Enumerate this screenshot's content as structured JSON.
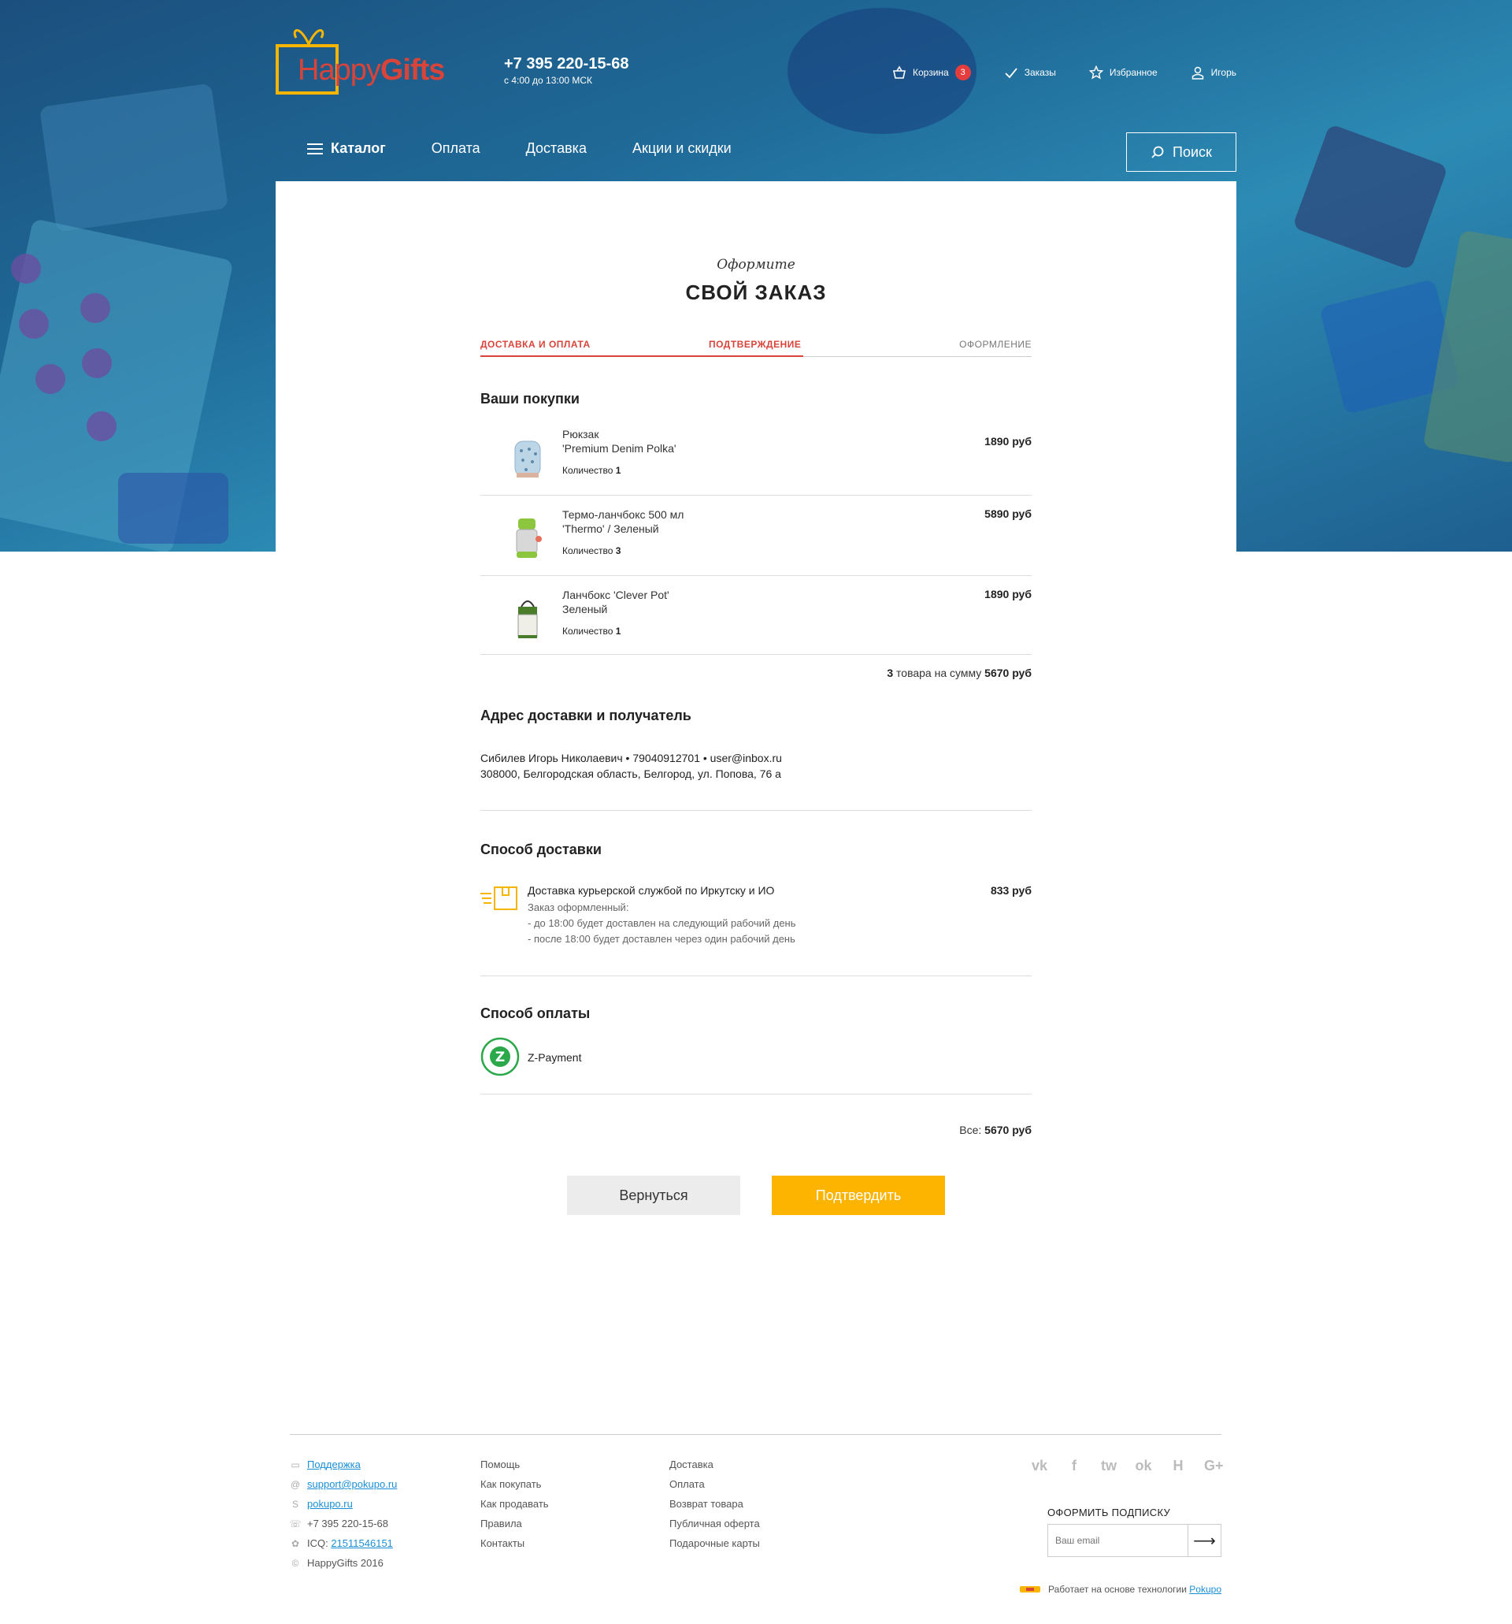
{
  "brand": {
    "logo_light": "Happy",
    "logo_bold": "Gifts",
    "phone": "+7 395 220-15-68",
    "hours": "с 4:00 до 13:00 МСК",
    "accent": "#d9443a",
    "gold": "#f7b500"
  },
  "topnav": {
    "cart_label": "Корзина",
    "cart_count": "3",
    "orders_label": "Заказы",
    "favorites_label": "Избранное",
    "user_label": "Игорь"
  },
  "mainnav": {
    "catalog": "Каталог",
    "payment": "Оплата",
    "delivery": "Доставка",
    "promos": "Акции и скидки",
    "search": "Поиск"
  },
  "checkout": {
    "subtitle": "Оформите",
    "title": "СВОЙ ЗАКАЗ",
    "steps": [
      "ДОСТАВКА И ОПЛАТА",
      "ПОДТВЕРЖДЕНИЕ",
      "ОФОРМЛЕНИЕ"
    ],
    "purchases_title": "Ваши покупки",
    "qty_label": "Количество",
    "products": [
      {
        "line1": "Рюкзак",
        "line2": "'Premium Denim Polka'",
        "qty": "1",
        "price": "1890 руб"
      },
      {
        "line1": "Термо-ланчбокс 500 мл",
        "line2": "'Thermo' / Зеленый",
        "qty": "3",
        "price": "5890 руб"
      },
      {
        "line1": "Ланчбокс 'Clever Pot'",
        "line2": "Зеленый",
        "qty": "1",
        "price": "1890 руб"
      }
    ],
    "summary": {
      "count": "3",
      "text": " товара на сумму ",
      "total": "5670 руб"
    },
    "address_title": "Адрес доставки и получатель",
    "address_line1": "Сибилев Игорь Николаевич • 79040912701 • user@inbox.ru",
    "address_line2": "308000, Белгородская область, Белгород, ул. Попова, 76 а",
    "delivery_title": "Способ доставки",
    "delivery_name": "Доставка курьерской службой по Иркутску и ИО",
    "delivery_note1": "Заказ оформленный:",
    "delivery_note2": "- до 18:00 будет доставлен на следующий рабочий день",
    "delivery_note3": "- после 18:00 будет доставлен через один рабочий день",
    "delivery_price": "833 руб",
    "payment_title": "Способ оплаты",
    "payment_name": "Z-Payment",
    "total_label": "Все: ",
    "total_value": "5670 руб",
    "back_button": "Вернуться",
    "confirm_button": "Подтвердить"
  },
  "footer": {
    "col1": {
      "support": "Поддержка",
      "email": "support@pokupo.ru",
      "skype": "pokupo.ru",
      "phone": "+7 395 220-15-68",
      "icq_label": "ICQ: ",
      "icq": "21511546151",
      "copyright": "HappyGifts 2016"
    },
    "col2": [
      "Помощь",
      "Как покупать",
      "Как продавать",
      "Правила",
      "Контакты"
    ],
    "col3": [
      "Доставка",
      "Оплата",
      "Возврат товара",
      "Публичная оферта",
      "Подарочные карты"
    ],
    "social": [
      "vk",
      "f",
      "tw",
      "ok",
      "H",
      "G+"
    ],
    "subscribe_title": "ОФОРМИТЬ ПОДПИСКУ",
    "subscribe_placeholder": "Ваш email",
    "powered_text": "Работает на основе технологии ",
    "powered_link": "Pokupo"
  }
}
